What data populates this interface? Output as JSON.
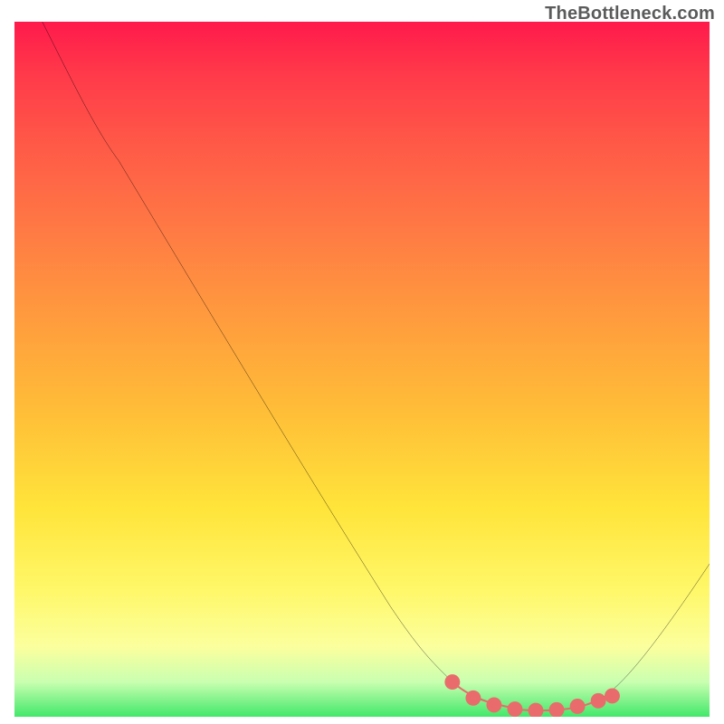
{
  "attribution": "TheBottleneck.com",
  "chart_data": {
    "type": "line",
    "title": "",
    "xlabel": "",
    "ylabel": "",
    "xlim": [
      0,
      100
    ],
    "ylim": [
      0,
      100
    ],
    "series": [
      {
        "name": "curve",
        "color": "#000000",
        "points": [
          {
            "x": 4,
            "y": 100
          },
          {
            "x": 15,
            "y": 80
          },
          {
            "x": 54,
            "y": 16
          },
          {
            "x": 62,
            "y": 6
          },
          {
            "x": 68,
            "y": 2
          },
          {
            "x": 78,
            "y": 1
          },
          {
            "x": 86,
            "y": 3
          },
          {
            "x": 100,
            "y": 22
          }
        ]
      },
      {
        "name": "optimal-band",
        "color": "#ea6b6b",
        "points": [
          {
            "x": 63,
            "y": 5
          },
          {
            "x": 68,
            "y": 2
          },
          {
            "x": 73,
            "y": 1
          },
          {
            "x": 78,
            "y": 1
          },
          {
            "x": 83,
            "y": 2
          },
          {
            "x": 86,
            "y": 3
          }
        ]
      }
    ],
    "gradient_stops": [
      {
        "pct": 0,
        "color": "#ff1a4b"
      },
      {
        "pct": 8,
        "color": "#ff3b4a"
      },
      {
        "pct": 18,
        "color": "#ff5a47"
      },
      {
        "pct": 30,
        "color": "#ff7a44"
      },
      {
        "pct": 42,
        "color": "#ff9a3e"
      },
      {
        "pct": 55,
        "color": "#ffbb38"
      },
      {
        "pct": 70,
        "color": "#ffe43a"
      },
      {
        "pct": 82,
        "color": "#fff86a"
      },
      {
        "pct": 90,
        "color": "#fbff9e"
      },
      {
        "pct": 95,
        "color": "#c9ffb0"
      },
      {
        "pct": 100,
        "color": "#42e86a"
      }
    ]
  }
}
